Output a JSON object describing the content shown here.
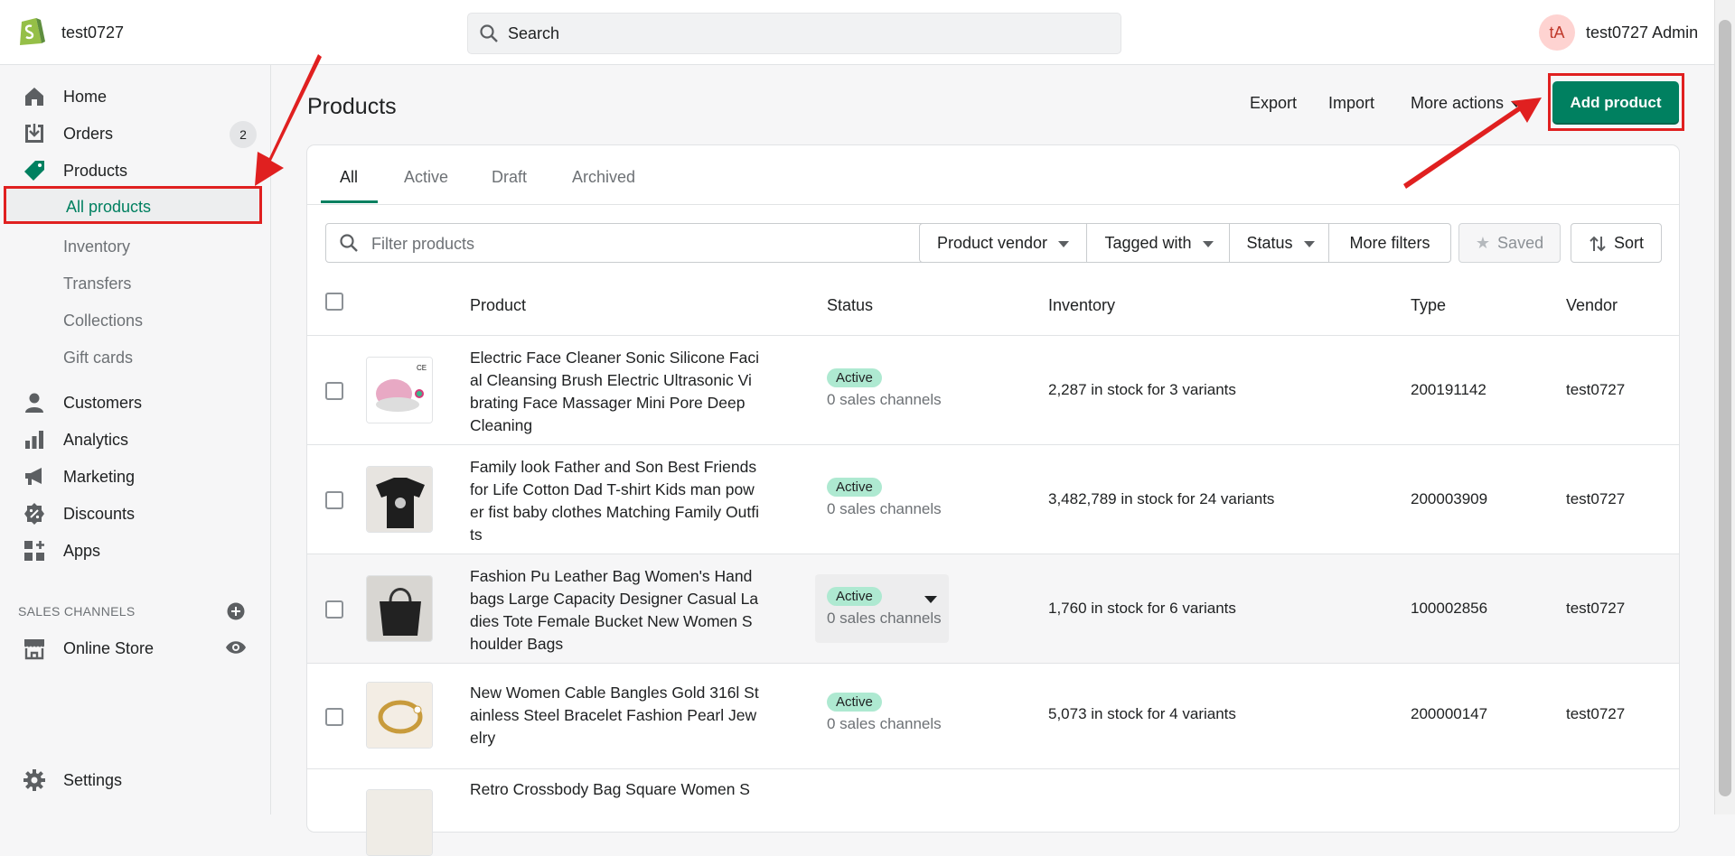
{
  "topbar": {
    "store_name": "test0727",
    "search_placeholder": "Search",
    "avatar_initials": "tA",
    "admin_name": "test0727 Admin"
  },
  "sidebar": {
    "items": [
      {
        "label": "Home",
        "icon": "home-icon"
      },
      {
        "label": "Orders",
        "icon": "orders-icon",
        "badge": "2"
      },
      {
        "label": "Products",
        "icon": "tag-icon"
      }
    ],
    "products_sub": [
      "All products",
      "Inventory",
      "Transfers",
      "Collections",
      "Gift cards"
    ],
    "items2": [
      {
        "label": "Customers",
        "icon": "person-icon"
      },
      {
        "label": "Analytics",
        "icon": "bar-chart-icon"
      },
      {
        "label": "Marketing",
        "icon": "megaphone-icon"
      },
      {
        "label": "Discounts",
        "icon": "discount-icon"
      },
      {
        "label": "Apps",
        "icon": "apps-icon"
      }
    ],
    "sales_channels_title": "SALES CHANNELS",
    "online_store": "Online Store",
    "settings": "Settings"
  },
  "page": {
    "title": "Products",
    "export": "Export",
    "import": "Import",
    "more_actions": "More actions",
    "add_product": "Add product"
  },
  "tabs": [
    "All",
    "Active",
    "Draft",
    "Archived"
  ],
  "filters": {
    "placeholder": "Filter products",
    "product_vendor": "Product vendor",
    "tagged_with": "Tagged with",
    "status": "Status",
    "more_filters": "More filters",
    "saved": "Saved",
    "sort": "Sort"
  },
  "table": {
    "headers": [
      "Product",
      "Status",
      "Inventory",
      "Type",
      "Vendor"
    ],
    "rows": [
      {
        "name": "Electric Face Cleaner Sonic Silicone Facial Cleansing Brush Electric Ultrasonic Vibrating Face Massager Mini Pore Deep Cleaning",
        "status": "Active",
        "channels": "0 sales channels",
        "inventory": "2,287 in stock for 3 variants",
        "type": "200191142",
        "vendor": "test0727"
      },
      {
        "name": "Family look Father and Son Best Friends for Life Cotton Dad T-shirt Kids man power fist baby clothes Matching Family Outfits",
        "status": "Active",
        "channels": "0 sales channels",
        "inventory": "3,482,789 in stock for 24 variants",
        "type": "200003909",
        "vendor": "test0727"
      },
      {
        "name": "Fashion Pu Leather Bag Women's Handbags Large Capacity Designer Casual Ladies Tote Female Bucket New Women Shoulder Bags",
        "status": "Active",
        "channels": "0 sales channels",
        "inventory": "1,760 in stock for 6 variants",
        "type": "100002856",
        "vendor": "test0727"
      },
      {
        "name": "New Women Cable Bangles Gold 316l Stainless Steel Bracelet Fashion Pearl Jewelry",
        "status": "Active",
        "channels": "0 sales channels",
        "inventory": "5,073 in stock for 4 variants",
        "type": "200000147",
        "vendor": "test0727"
      },
      {
        "name": "Retro Crossbody Bag Square Women S"
      }
    ]
  },
  "colors": {
    "accent": "#008060",
    "annotation": "#e02020",
    "active_pill": "#aee9d1"
  }
}
